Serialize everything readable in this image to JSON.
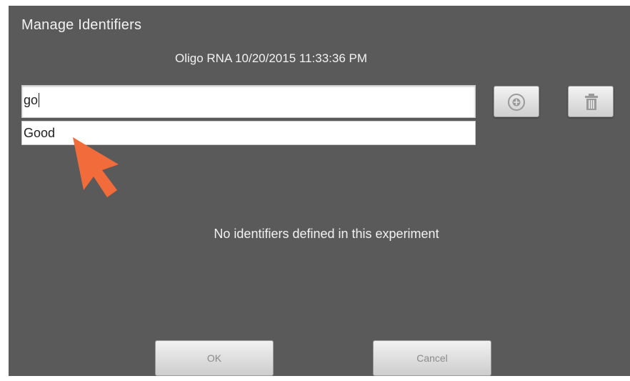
{
  "dialog": {
    "title": "Manage Identifiers",
    "subtitle": "Oligo RNA 10/20/2015 11:33:36 PM"
  },
  "search": {
    "value": "go",
    "suggestion": "Good"
  },
  "toolbar": {
    "add_icon": "add-circle-icon",
    "delete_icon": "trash-icon"
  },
  "main": {
    "empty_message": "No identifiers defined in this experiment"
  },
  "footer": {
    "ok_label": "OK",
    "cancel_label": "Cancel"
  },
  "colors": {
    "dialog_bg": "#5a5a5a",
    "pointer": "#f26b3a"
  }
}
